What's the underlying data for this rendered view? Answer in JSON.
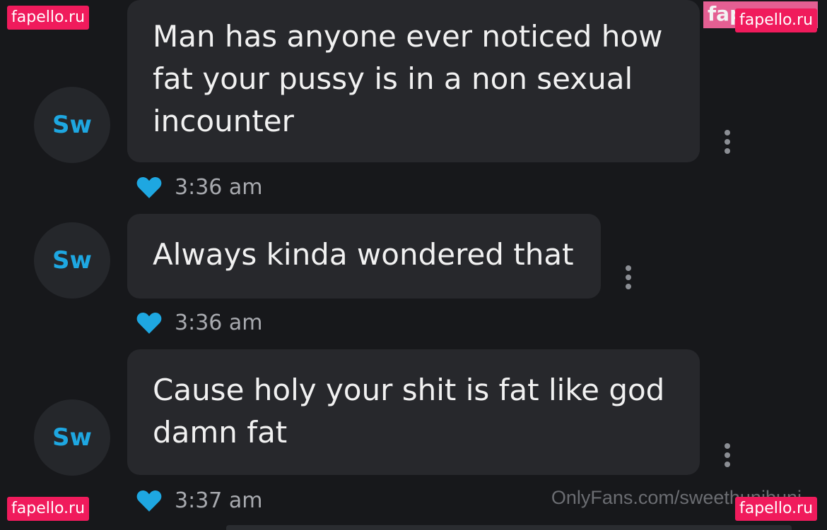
{
  "messages": [
    {
      "avatar": "Sw",
      "text": "Man has anyone ever noticed how fat your pussy is in a non sexual incounter",
      "time": "3:36 am",
      "liked": true,
      "more_icon": "more-vertical-icon"
    },
    {
      "avatar": "Sw",
      "text": "Always kinda wondered that",
      "time": "3:36 am",
      "liked": true,
      "more_icon": "more-vertical-icon"
    },
    {
      "avatar": "Sw",
      "text": "Cause holy your shit is fat like god damn fat",
      "time": "3:37 am",
      "liked": true,
      "more_icon": "more-vertical-icon"
    }
  ],
  "watermarks": {
    "site": "fapello.ru",
    "site_partial": "fap",
    "onlyfans": "OnlyFans.com/sweethunibuni"
  },
  "colors": {
    "background": "#17181b",
    "bubble": "#27282c",
    "avatar_bg": "#25272b",
    "accent": "#1ea7e1",
    "timestamp": "#a8aaaf",
    "watermark": "#f01b5c"
  }
}
